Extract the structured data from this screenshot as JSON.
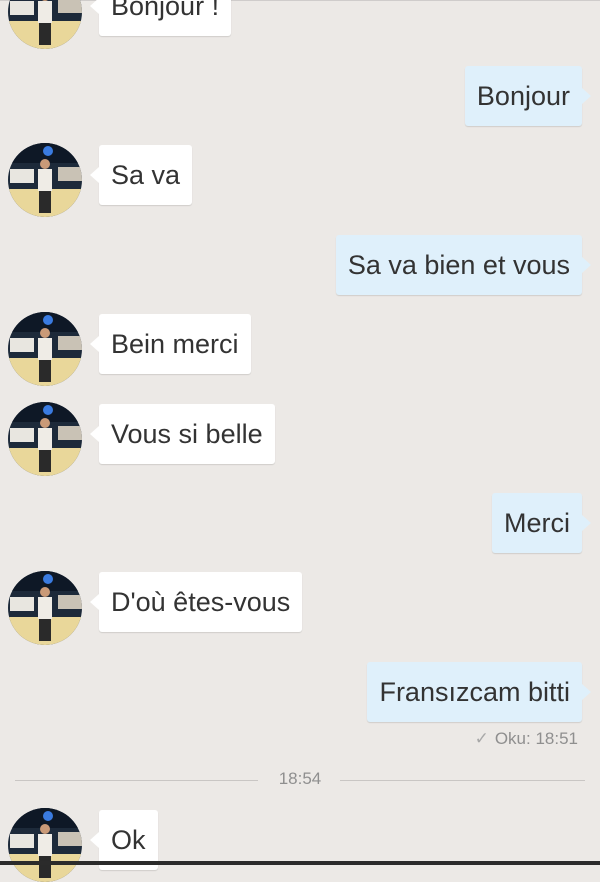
{
  "colors": {
    "background": "#ece9e6",
    "incoming_bubble": "#ffffff",
    "outgoing_bubble": "#dff0fb",
    "text": "#333333",
    "meta_text": "#8f8f8f"
  },
  "messages": [
    {
      "side": "incoming",
      "text": "Bonjour !"
    },
    {
      "side": "outgoing",
      "text": "Bonjour"
    },
    {
      "side": "incoming",
      "text": "Sa va"
    },
    {
      "side": "outgoing",
      "text": "Sa va bien et vous"
    },
    {
      "side": "incoming",
      "text": "Bein merci"
    },
    {
      "side": "incoming",
      "text": "Vous si belle"
    },
    {
      "side": "outgoing",
      "text": "Merci"
    },
    {
      "side": "incoming",
      "text": "D'où êtes-vous"
    },
    {
      "side": "outgoing",
      "text": "Fransızcam bitti"
    },
    {
      "side": "incoming",
      "text": "Ok"
    }
  ],
  "read_receipt": {
    "icon": "checkmark-icon",
    "text": "Oku: 18:51"
  },
  "time_divider": "18:54",
  "avatar": {
    "icon": "contact-avatar"
  }
}
